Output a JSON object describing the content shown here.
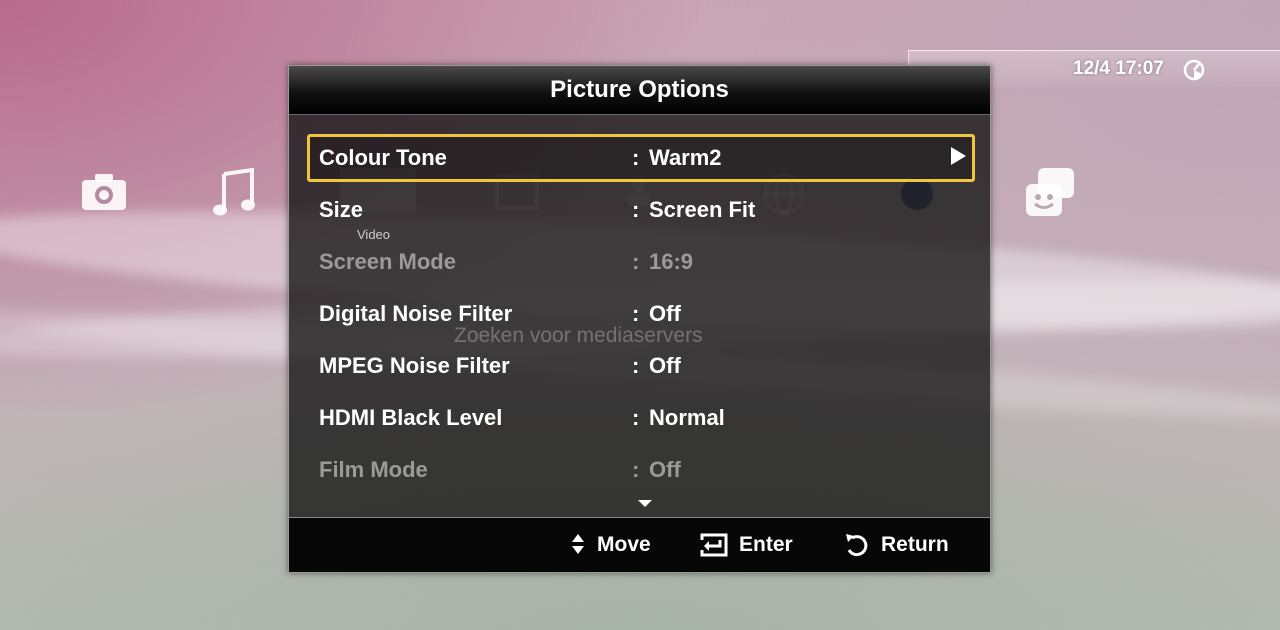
{
  "status_bar": {
    "datetime": "12/4 17:07"
  },
  "background": {
    "icons": [
      "camera-icon",
      "music-icon",
      "film-icon",
      "tv-icon",
      "person-icon",
      "globe-icon",
      "network-icon",
      "friends-icon"
    ],
    "overlay_text": "Zoeken voor mediaservers",
    "sublabel": "Video"
  },
  "dialog": {
    "title": "Picture Options",
    "options": [
      {
        "label": "Colour Tone",
        "value": "Warm2",
        "state": "selected"
      },
      {
        "label": "Size",
        "value": "Screen Fit",
        "state": "normal"
      },
      {
        "label": "Screen Mode",
        "value": "16:9",
        "state": "disabled"
      },
      {
        "label": "Digital Noise Filter",
        "value": "Off",
        "state": "normal"
      },
      {
        "label": "MPEG Noise Filter",
        "value": "Off",
        "state": "normal"
      },
      {
        "label": "HDMI Black Level",
        "value": "Normal",
        "state": "normal"
      },
      {
        "label": "Film Mode",
        "value": "Off",
        "state": "disabled"
      }
    ],
    "separator": ":",
    "footer": {
      "move_label": "Move",
      "enter_label": "Enter",
      "return_label": "Return"
    }
  },
  "colors": {
    "highlight": "#f0c53a",
    "disabled_text": "#9a9a9a"
  }
}
